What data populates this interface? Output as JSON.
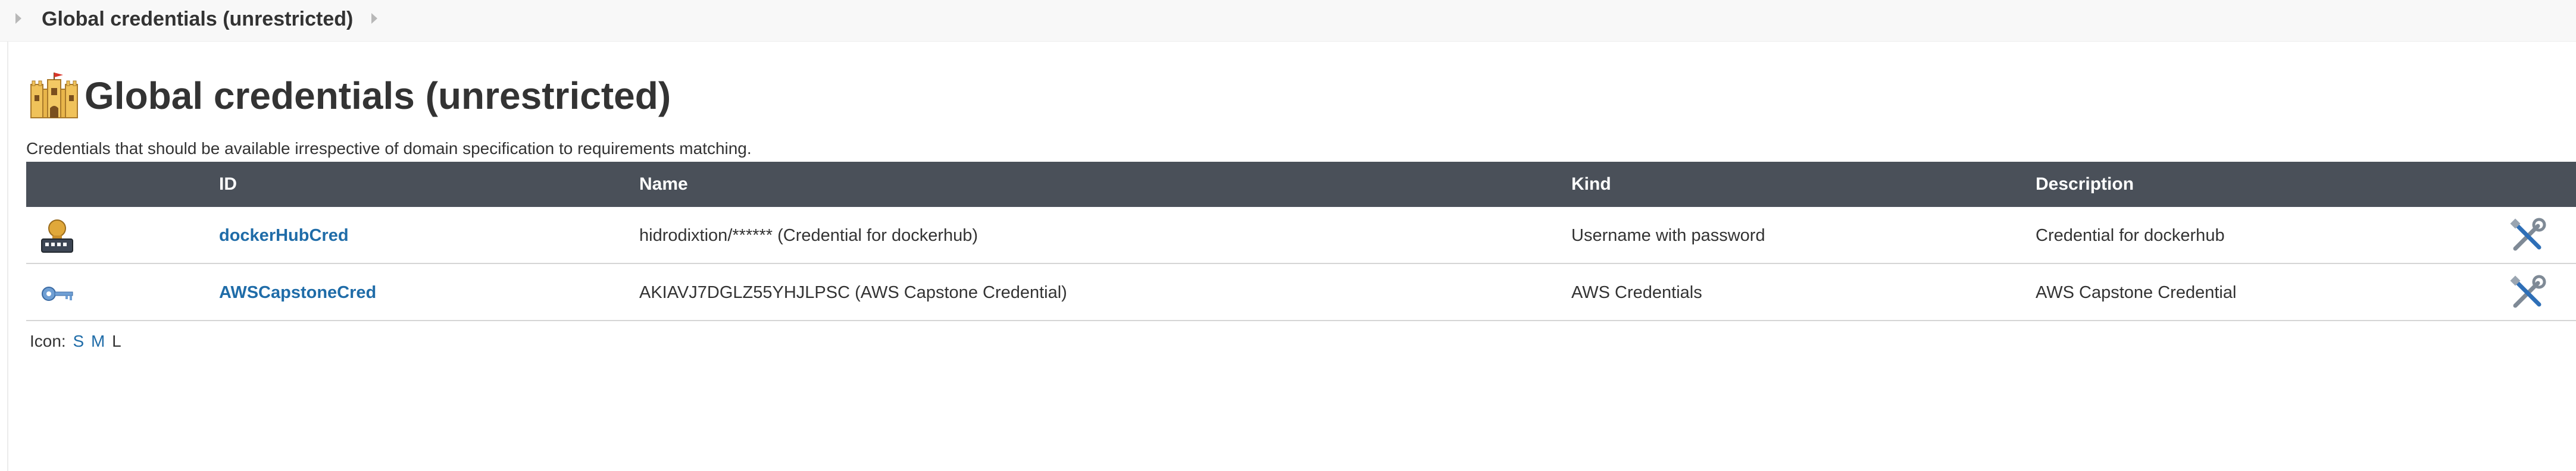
{
  "breadcrumb": {
    "current": "Global credentials (unrestricted)"
  },
  "page": {
    "title": "Global credentials (unrestricted)",
    "description": "Credentials that should be available irrespective of domain specification to requirements matching."
  },
  "table": {
    "headers": {
      "id": "ID",
      "name": "Name",
      "kind": "Kind",
      "description": "Description"
    },
    "rows": [
      {
        "icon": "username-password-icon",
        "id": "dockerHubCred",
        "name": "hidrodixtion/****** (Credential for dockerhub)",
        "kind": "Username with password",
        "description": "Credential for dockerhub"
      },
      {
        "icon": "key-icon",
        "id": "AWSCapstoneCred",
        "name": "AKIAVJ7DGLZ55YHJLPSC (AWS Capstone Credential)",
        "kind": "AWS Credentials",
        "description": "AWS Capstone Credential"
      }
    ]
  },
  "icon_size": {
    "label": "Icon:",
    "small": "S",
    "medium": "M",
    "large": "L"
  },
  "colors": {
    "header_bg": "#4a5059",
    "link": "#1f6ca8",
    "text": "#333333"
  }
}
